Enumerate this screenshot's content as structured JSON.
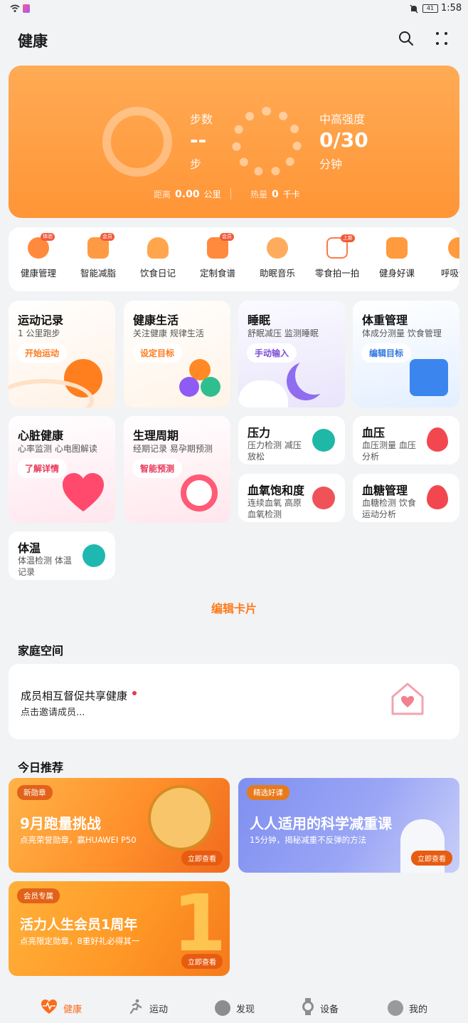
{
  "status_bar": {
    "time": "1:58",
    "battery": "41"
  },
  "app": {
    "title": "健康"
  },
  "hero": {
    "steps_label": "步数",
    "steps_value": "--",
    "steps_unit": "步",
    "intensity_label": "中高强度",
    "intensity_value": "0/30",
    "intensity_unit": "分钟",
    "distance_label": "距离",
    "distance_value": "0.00",
    "distance_unit": "公里",
    "calorie_label": "热量",
    "calorie_value": "0",
    "calorie_unit": "千卡"
  },
  "shortcuts": [
    {
      "label": "健康管理",
      "badge": "体验",
      "color": "#ff8a3d"
    },
    {
      "label": "智能减脂",
      "badge": "会员",
      "color": "#ff9a44"
    },
    {
      "label": "饮食日记",
      "badge": "",
      "color": "#ffa64d"
    },
    {
      "label": "定制食谱",
      "badge": "会员",
      "color": "#ff8a3d"
    },
    {
      "label": "助眠音乐",
      "badge": "",
      "color": "#ffab5e"
    },
    {
      "label": "零食拍一拍",
      "badge": "上新",
      "color": "#ff7a45"
    },
    {
      "label": "健身好课",
      "badge": "",
      "color": "#ff9a3e"
    },
    {
      "label": "呼吸训",
      "badge": "",
      "color": "#ff9a3e"
    }
  ],
  "cards": {
    "exercise": {
      "title": "运动记录",
      "subtitle": "1 公里跑步",
      "action": "开始运动"
    },
    "life": {
      "title": "健康生活",
      "subtitle": "关注健康 规律生活",
      "action": "设定目标"
    },
    "sleep": {
      "title": "睡眠",
      "subtitle": "舒眠减压 监测睡眠",
      "action": "手动输入"
    },
    "weight": {
      "title": "体重管理",
      "subtitle": "体成分测量 饮食管理",
      "action": "编辑目标"
    },
    "heart": {
      "title": "心脏健康",
      "subtitle": "心率监测 心电图解读",
      "action": "了解详情"
    },
    "cycle": {
      "title": "生理周期",
      "subtitle": "经期记录 易孕期预测",
      "action": "智能预测"
    },
    "stress": {
      "title": "压力",
      "subtitle_1": "压力检测 减压",
      "subtitle_2": "放松"
    },
    "bp": {
      "title": "血压",
      "subtitle_1": "血压测量 血压",
      "subtitle_2": "分析"
    },
    "spo2": {
      "title": "血氧饱和度",
      "subtitle_1": "连续血氧 高原",
      "subtitle_2": "血氧检测"
    },
    "glucose": {
      "title": "血糖管理",
      "subtitle_1": "血糖检测 饮食",
      "subtitle_2": "运动分析"
    },
    "temp": {
      "title": "体温",
      "subtitle_1": "体温检测 体温",
      "subtitle_2": "记录"
    }
  },
  "edit_cards": "编辑卡片",
  "family": {
    "section_title": "家庭空间",
    "headline": "成员相互督促共享健康",
    "subtext": "点击邀请成员..."
  },
  "recommend": {
    "section_title": "今日推荐",
    "banners": [
      {
        "tag": "新勋章",
        "title": "9月跑量挑战",
        "subtitle": "点亮荣誉勋章，赢HUAWEI P50",
        "cta": "立即查看"
      },
      {
        "tag": "精选好课",
        "title": "人人适用的科学减重课",
        "subtitle": "15分钟，揭秘减重不反弹的方法",
        "cta": "立即查看"
      },
      {
        "tag": "会员专属",
        "title": "活力人生会员1周年",
        "subtitle": "点亮限定勋章，8重好礼必得其一",
        "cta": "立即查看"
      }
    ]
  },
  "nav": [
    {
      "label": "健康",
      "icon": "heart-pulse-icon",
      "active": true
    },
    {
      "label": "运动",
      "icon": "runner-icon",
      "active": false
    },
    {
      "label": "发现",
      "icon": "planet-icon",
      "active": false
    },
    {
      "label": "设备",
      "icon": "watch-icon",
      "active": false
    },
    {
      "label": "我的",
      "icon": "avatar-icon",
      "active": false
    }
  ],
  "colors": {
    "accent": "#ff8a2a",
    "hero": "#ff9c40",
    "background": "#f1f3f5"
  }
}
